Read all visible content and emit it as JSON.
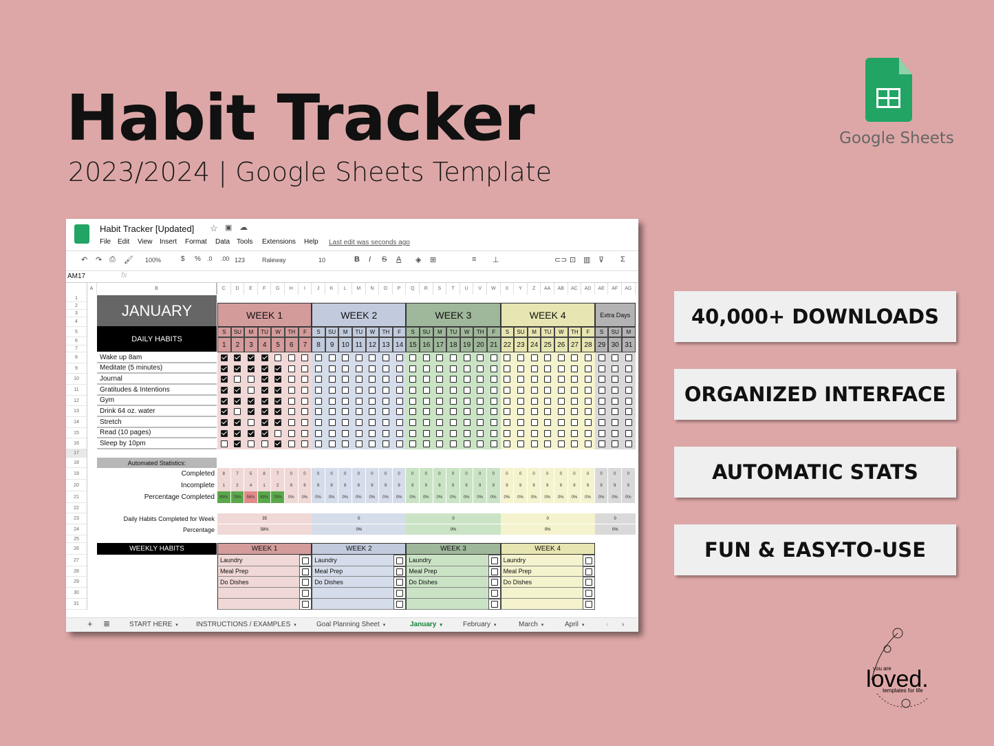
{
  "hero": {
    "title": "Habit Tracker",
    "subtitle": "2023/2024 | Google Sheets Template"
  },
  "brand": {
    "logo_text": "Google Sheets",
    "maker_logo": "you are loved. templates for life"
  },
  "badges": [
    "40,000+ DOWNLOADS",
    "ORGANIZED INTERFACE",
    "AUTOMATIC STATS",
    "FUN & EASY-TO-USE"
  ],
  "colors": {
    "background": "#dea7a7",
    "sheets_green": "#21a464",
    "week1": "#d49b9b",
    "week1_light": "#f0d8d6",
    "week2": "#c2cbdd",
    "week2_light": "#d5dcea",
    "week3": "#9fb79a",
    "week3_light": "#cae3c5",
    "week4": "#e7e5b1",
    "week4_light": "#f4f3cd",
    "extra": "#b3b3b3",
    "extra_light": "#d9d9d9",
    "good": "#5aa84a",
    "bad": "#e08a8a"
  },
  "app": {
    "doc_title": "Habit Tracker [Updated]",
    "menu": [
      "File",
      "Edit",
      "View",
      "Insert",
      "Format",
      "Data",
      "Tools",
      "Extensions",
      "Help"
    ],
    "last_edit": "Last edit was seconds ago",
    "toolbar": {
      "zoom": "100%",
      "currency": "$",
      "percent": "%",
      "dec_less": ".0",
      "dec_more": ".00",
      "format": "123",
      "font": "Raleway",
      "size": "10"
    },
    "cell_ref": "AM17",
    "fx": "fx",
    "columns": [
      "A",
      "B",
      "C",
      "D",
      "E",
      "F",
      "G",
      "H",
      "I",
      "J",
      "K",
      "L",
      "M",
      "N",
      "O",
      "P",
      "Q",
      "R",
      "S",
      "T",
      "U",
      "V",
      "W",
      "X",
      "Y",
      "Z",
      "AA",
      "AB",
      "AC",
      "AD",
      "AE",
      "AF",
      "AG"
    ],
    "tabs": [
      "START HERE",
      "INSTRUCTIONS / EXAMPLES",
      "Goal Planning Sheet",
      "January",
      "February",
      "March",
      "April"
    ],
    "active_tab": "January"
  },
  "sheet": {
    "month": "JANUARY",
    "daily_label": "DAILY HABITS",
    "weeks": [
      "WEEK 1",
      "WEEK 2",
      "WEEK 3",
      "WEEK 4",
      "Extra Days"
    ],
    "day_letters": [
      "S",
      "SU",
      "M",
      "TU",
      "W",
      "TH",
      "F",
      "S",
      "SU",
      "M",
      "TU",
      "W",
      "TH",
      "F",
      "S",
      "SU",
      "M",
      "TU",
      "W",
      "TH",
      "F",
      "S",
      "SU",
      "M",
      "TU",
      "W",
      "TH",
      "F",
      "S",
      "SU",
      "M"
    ],
    "habits": [
      {
        "name": "Wake up 8am",
        "done": [
          1,
          1,
          1,
          1,
          0,
          0,
          0
        ]
      },
      {
        "name": "Meditate (5 minutes)",
        "done": [
          1,
          1,
          1,
          1,
          1,
          0,
          0
        ]
      },
      {
        "name": "Journal",
        "done": [
          1,
          0,
          0,
          1,
          1,
          0,
          0
        ]
      },
      {
        "name": "Gratitudes & Intentions",
        "done": [
          1,
          1,
          0,
          1,
          1,
          0,
          0
        ]
      },
      {
        "name": "Gym",
        "done": [
          1,
          1,
          1,
          1,
          1,
          0,
          0
        ]
      },
      {
        "name": "Drink 64 oz. water",
        "done": [
          1,
          0,
          1,
          1,
          1,
          0,
          0
        ]
      },
      {
        "name": "Stretch",
        "done": [
          1,
          1,
          0,
          1,
          1,
          0,
          0
        ]
      },
      {
        "name": "Read (10 pages)",
        "done": [
          1,
          1,
          1,
          1,
          0,
          0,
          0
        ]
      },
      {
        "name": "Sleep by 10pm",
        "done": [
          0,
          1,
          0,
          0,
          1,
          0,
          0
        ]
      }
    ],
    "stats_label": "Automated Statistics:",
    "completed_label": "Completed",
    "incomplete_label": "Incomplete",
    "pct_label": "Percentage Completed",
    "completed": [
      8,
      7,
      5,
      8,
      7,
      0,
      0,
      0,
      0,
      0,
      0,
      0,
      0,
      0,
      0,
      0,
      0,
      0,
      0,
      0,
      0,
      0,
      0,
      0,
      0,
      0,
      0,
      0,
      0,
      0,
      0
    ],
    "incomplete": [
      1,
      2,
      4,
      1,
      2,
      9,
      9,
      9,
      9,
      9,
      9,
      9,
      9,
      9,
      9,
      9,
      9,
      9,
      9,
      9,
      9,
      9,
      9,
      9,
      9,
      9,
      9,
      9,
      9,
      9,
      9
    ],
    "pct": [
      "89%",
      "78%",
      "56%",
      "89%",
      "78%",
      "0%",
      "0%",
      "0%",
      "0%",
      "0%",
      "0%",
      "0%",
      "0%",
      "0%",
      "0%",
      "0%",
      "0%",
      "0%",
      "0%",
      "0%",
      "0%",
      "0%",
      "0%",
      "0%",
      "0%",
      "0%",
      "0%",
      "0%",
      "0%",
      "0%",
      "0%"
    ],
    "week_total_label": "Daily Habits Completed for Week",
    "week_pct_label": "Percentage",
    "week_totals": [
      "35",
      "0",
      "0",
      "0",
      "0"
    ],
    "week_pcts": [
      "58%",
      "0%",
      "0%",
      "0%",
      "0%"
    ],
    "weekly_label": "WEEKLY HABITS",
    "weekly_items": [
      "Laundry",
      "Meal Prep",
      "Do Dishes",
      "",
      ""
    ]
  }
}
